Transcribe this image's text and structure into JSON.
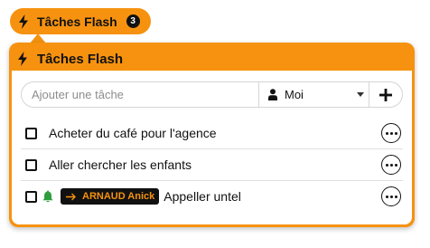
{
  "header_button": {
    "label": "Tâches Flash",
    "count": "3",
    "icon": "bolt-icon"
  },
  "panel": {
    "title": "Tâches Flash",
    "icon": "bolt-icon"
  },
  "add_task": {
    "placeholder": "Ajouter une tâche",
    "assignee": {
      "value": "Moi",
      "icon": "person-icon"
    },
    "add_icon": "plus-icon"
  },
  "tasks": [
    {
      "text": "Acheter du café pour l'agence",
      "checked": false
    },
    {
      "text": "Aller chercher les enfants",
      "checked": false
    },
    {
      "text": "Appeller untel",
      "checked": false,
      "bell": true,
      "assigned_to": "ARNAUD Anick"
    }
  ],
  "colors": {
    "accent": "#f6920f",
    "bell": "#2e9e3c",
    "text": "#111111"
  }
}
